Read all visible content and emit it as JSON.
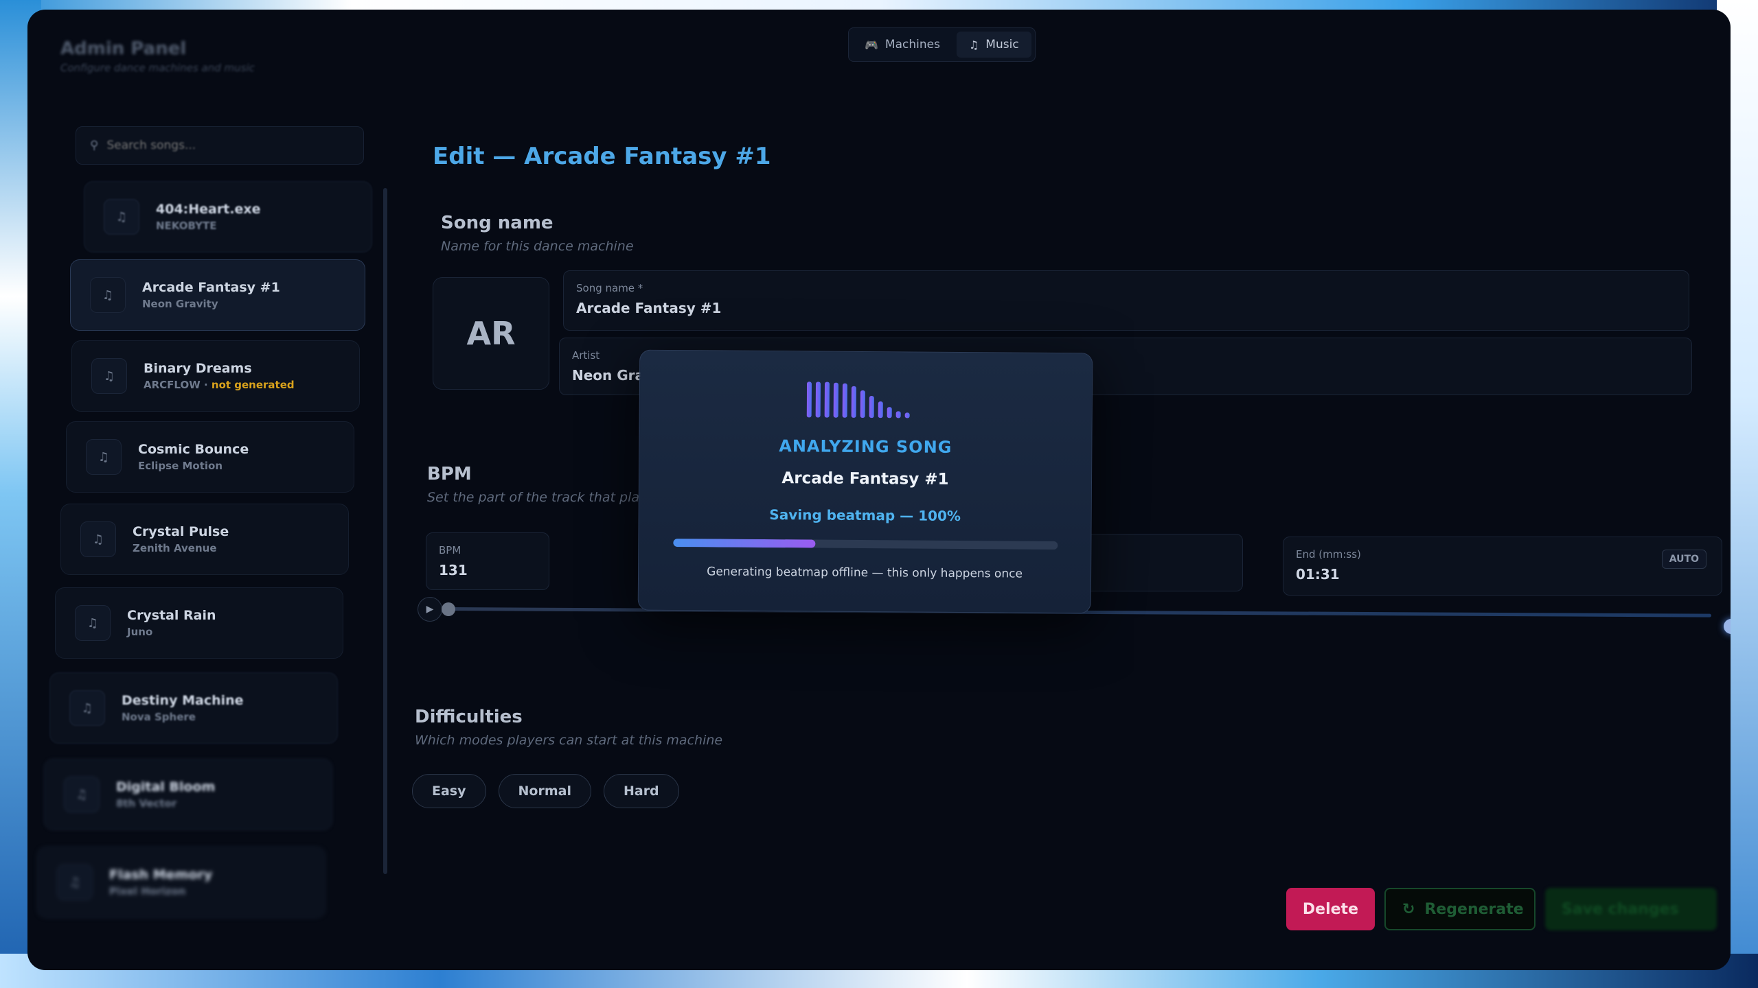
{
  "header": {
    "app_title": "Admin Panel",
    "app_subtitle": "Configure dance machines and music",
    "tabs": [
      {
        "label": "Machines",
        "icon": "gamepad-icon"
      },
      {
        "label": "Music",
        "icon": "music-note-icon",
        "active": true
      }
    ]
  },
  "sidebar": {
    "search": {
      "placeholder": "Search songs..."
    },
    "songs": [
      {
        "title": "404:Heart.exe",
        "artist": "NEKOBYTE",
        "status": ""
      },
      {
        "title": "Arcade Fantasy #1",
        "artist": "Neon Gravity",
        "status": "",
        "active": true
      },
      {
        "title": "Binary Dreams",
        "artist": "ARCFLOW",
        "status": "not generated"
      },
      {
        "title": "Cosmic Bounce",
        "artist": "Eclipse Motion",
        "status": ""
      },
      {
        "title": "Crystal Pulse",
        "artist": "Zenith Avenue",
        "status": ""
      },
      {
        "title": "Crystal Rain",
        "artist": "Juno",
        "status": ""
      },
      {
        "title": "Destiny Machine",
        "artist": "Nova Sphere",
        "status": ""
      },
      {
        "title": "Digital Bloom",
        "artist": "8th Vector",
        "status": ""
      },
      {
        "title": "Flash Memory",
        "artist": "Pixel Horizon",
        "status": ""
      }
    ]
  },
  "editor": {
    "title": "Edit — Arcade Fantasy #1",
    "song_section": {
      "title": "Song name",
      "subtitle": "Name for this dance machine"
    },
    "avatar_initials": "AR",
    "song_name": {
      "label": "Song name *",
      "value": "Arcade Fantasy #1"
    },
    "artist": {
      "label": "Artist",
      "value": "Neon Gravity"
    },
    "bpm_section": {
      "title": "BPM",
      "subtitle": "Set the part of the track that plays"
    },
    "bpm": {
      "label": "BPM",
      "value": "131"
    },
    "end": {
      "label": "End (mm:ss)",
      "value": "01:31",
      "badge": "AUTO"
    },
    "difficulties_section": {
      "title": "Difficulties",
      "subtitle": "Which modes players can start at this machine"
    },
    "difficulties": [
      "Easy",
      "Normal",
      "Hard"
    ],
    "actions": {
      "delete": "Delete",
      "regenerate": "Regenerate",
      "save": "Save changes"
    }
  },
  "modal": {
    "heading": "ANALYZING SONG",
    "song": "Arcade Fantasy #1",
    "status": "Saving beatmap — 100%",
    "progress": 0.37,
    "note": "Generating beatmap offline — this only happens once"
  },
  "colors": {
    "accent": "#40a8ee",
    "danger": "#c21a55",
    "warning": "#d9a21c",
    "progress_start": "#4a8ff0",
    "progress_end": "#9a5cf0"
  }
}
